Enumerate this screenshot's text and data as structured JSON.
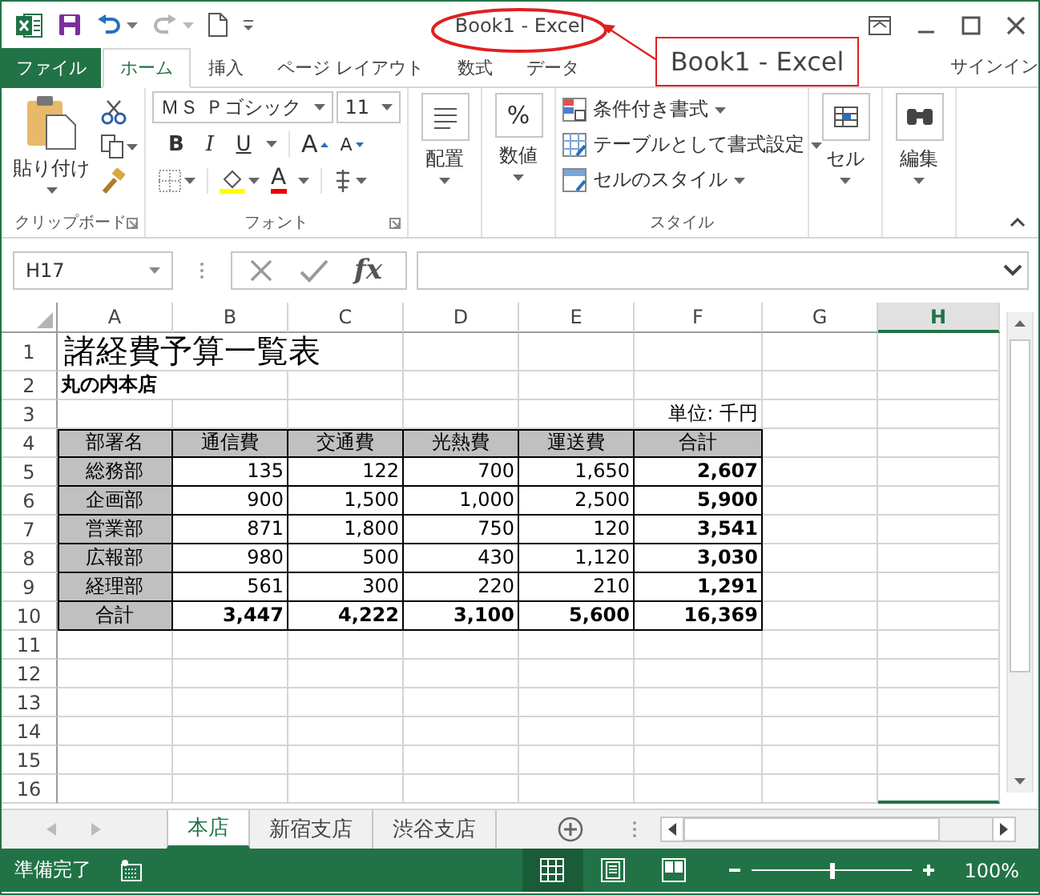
{
  "title_bar": {
    "title": "Book1 - Excel"
  },
  "annotation": {
    "callout": "Book1 - Excel"
  },
  "ribbon_tabs": [
    {
      "label": "ファイル",
      "kind": "file",
      "selected": false
    },
    {
      "label": "ホーム",
      "kind": "tab",
      "selected": true
    },
    {
      "label": "挿入",
      "kind": "tab",
      "selected": false
    },
    {
      "label": "ページ レイアウト",
      "kind": "tab",
      "selected": false
    },
    {
      "label": "数式",
      "kind": "tab",
      "selected": false
    },
    {
      "label": "データ",
      "kind": "tab",
      "selected": false
    }
  ],
  "sign_in": "サインイン",
  "ribbon": {
    "clipboard": {
      "label": "クリップボード",
      "paste": "貼り付け"
    },
    "font": {
      "label": "フォント",
      "font_name": "ＭＳ Ｐゴシック",
      "font_size": "11",
      "bold": "B",
      "italic": "I",
      "underline": "U",
      "grow": "A",
      "shrink": "A",
      "font_color": "A"
    },
    "alignment": {
      "label": "配置"
    },
    "number": {
      "label": "数値",
      "symbol": "%"
    },
    "styles": {
      "label": "スタイル",
      "items": [
        "条件付き書式",
        "テーブルとして書式設定",
        "セルのスタイル"
      ]
    },
    "cells": {
      "label": "セル"
    },
    "editing": {
      "label": "編集"
    }
  },
  "formula_bar": {
    "name_box": "H17",
    "function_symbol": "fx"
  },
  "sheet": {
    "columns": [
      {
        "label": "A",
        "selected": false
      },
      {
        "label": "B",
        "selected": false
      },
      {
        "label": "C",
        "selected": false
      },
      {
        "label": "D",
        "selected": false
      },
      {
        "label": "E",
        "selected": false
      },
      {
        "label": "F",
        "selected": false
      },
      {
        "label": "G",
        "selected": false
      },
      {
        "label": "H",
        "selected": true
      }
    ],
    "rows": [
      {
        "number": "1",
        "kind": "title",
        "cells": [
          "諸経費予算一覧表"
        ]
      },
      {
        "number": "2",
        "kind": "subtitle",
        "cells": [
          "丸の内本店"
        ]
      },
      {
        "number": "3",
        "kind": "unit",
        "cells": [
          "単位: 千円"
        ]
      },
      {
        "number": "4",
        "kind": "header",
        "cells": [
          "部署名",
          "通信費",
          "交通費",
          "光熱費",
          "運送費",
          "合計"
        ]
      },
      {
        "number": "5",
        "kind": "data",
        "cells": [
          "総務部",
          "135",
          "122",
          "700",
          "1,650",
          "2,607"
        ]
      },
      {
        "number": "6",
        "kind": "data",
        "cells": [
          "企画部",
          "900",
          "1,500",
          "1,000",
          "2,500",
          "5,900"
        ]
      },
      {
        "number": "7",
        "kind": "data",
        "cells": [
          "営業部",
          "871",
          "1,800",
          "750",
          "120",
          "3,541"
        ]
      },
      {
        "number": "8",
        "kind": "data",
        "cells": [
          "広報部",
          "980",
          "500",
          "430",
          "1,120",
          "3,030"
        ]
      },
      {
        "number": "9",
        "kind": "data",
        "cells": [
          "経理部",
          "561",
          "300",
          "220",
          "210",
          "1,291"
        ]
      },
      {
        "number": "10",
        "kind": "total",
        "cells": [
          "合計",
          "3,447",
          "4,222",
          "3,100",
          "5,600",
          "16,369"
        ]
      },
      {
        "number": "11",
        "kind": "empty"
      },
      {
        "number": "12",
        "kind": "empty"
      },
      {
        "number": "13",
        "kind": "empty"
      },
      {
        "number": "14",
        "kind": "empty"
      },
      {
        "number": "15",
        "kind": "empty"
      },
      {
        "number": "16",
        "kind": "empty"
      }
    ]
  },
  "sheet_tabs": [
    {
      "label": "本店",
      "selected": true
    },
    {
      "label": "新宿支店",
      "selected": false
    },
    {
      "label": "渋谷支店",
      "selected": false
    }
  ],
  "status_bar": {
    "status": "準備完了",
    "views": [
      {
        "kind": "normal",
        "selected": true
      },
      {
        "kind": "page_layout",
        "selected": false
      },
      {
        "kind": "page_break",
        "selected": false
      }
    ],
    "zoom": {
      "level": 0.5
    },
    "zoom_percent": "100%"
  }
}
